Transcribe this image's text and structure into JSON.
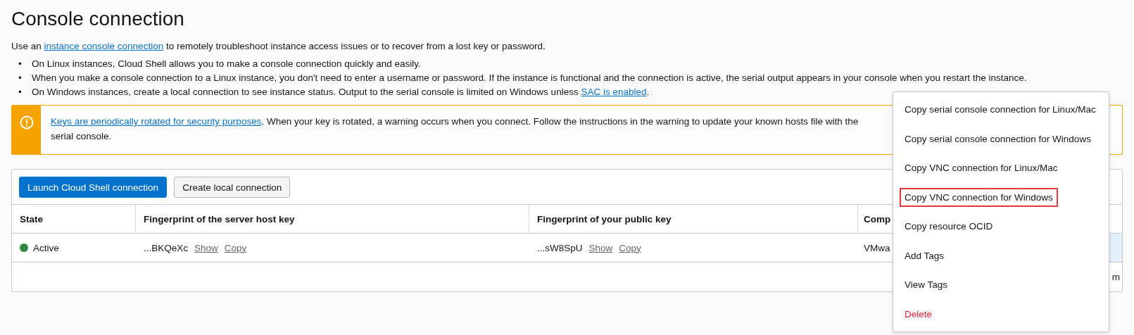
{
  "title": "Console connection",
  "intro": {
    "before": "Use an ",
    "link": "instance console connection",
    "after": " to remotely troubleshoot instance access issues or to recover from a lost key or password."
  },
  "bullet_marker": "•",
  "bullets": [
    {
      "text": "On Linux instances, Cloud Shell allows you to make a console connection quickly and easily."
    },
    {
      "text": "When you make a console connection to a Linux instance, you don't need to enter a username or password. If the instance is functional and the connection is active, the serial output appears in your console when you restart the instance."
    },
    {
      "text": "On Windows instances, create a local connection to see instance status. Output to the serial console is limited on Windows unless ",
      "link": "SAC is enabled",
      "after": "."
    }
  ],
  "warning": {
    "link": "Keys are periodically rotated for security purposes",
    "line1": ". When your key is rotated, a warning occurs when you connect. Follow the instructions in the warning to update your known hosts file with the",
    "line2": "serial console."
  },
  "buttons": [
    {
      "label": "Launch Cloud Shell connection",
      "kind": "primary"
    },
    {
      "label": "Create local connection",
      "kind": "secondary"
    }
  ],
  "table": {
    "columns": [
      "State",
      "Fingerprint of the server host key",
      "Fingerprint of your public key",
      "Comp"
    ],
    "rows": [
      {
        "state": "Active",
        "color": "#2d8a3e",
        "server_key": "...BKQeXc",
        "public_key": "...sW8SpU",
        "column_4": "VMwa",
        "server_actions": [
          "Show",
          "Copy"
        ],
        "public_actions": [
          "Show",
          "Copy"
        ]
      }
    ],
    "footer": "m"
  },
  "menu": [
    {
      "label": "Copy serial console connection for Linux/Mac",
      "kind": "normal",
      "outlined": false
    },
    {
      "label": "Copy serial console connection for Windows",
      "kind": "normal",
      "outlined": false
    },
    {
      "label": "Copy VNC connection for Linux/Mac",
      "kind": "normal",
      "outlined": false
    },
    {
      "label": "Copy VNC connection for Windows",
      "kind": "normal",
      "outlined": true
    },
    {
      "label": "Copy resource OCID",
      "kind": "normal",
      "outlined": false
    },
    {
      "label": "Add Tags",
      "kind": "normal",
      "outlined": false
    },
    {
      "label": "View Tags",
      "kind": "normal",
      "outlined": false
    },
    {
      "label": "Delete",
      "kind": "danger",
      "outlined": false
    }
  ]
}
